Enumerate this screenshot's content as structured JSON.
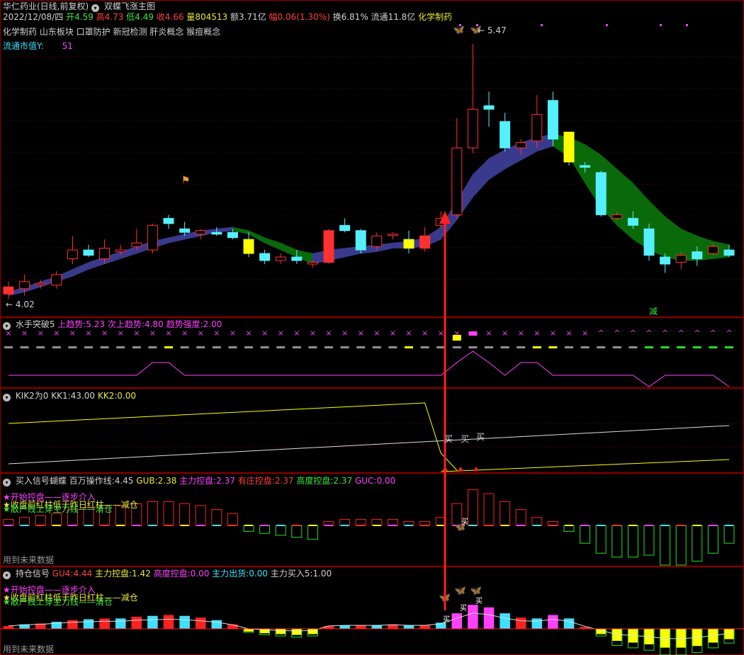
{
  "header": {
    "stock_name": "华仁药业(日线,前复权)",
    "formula_name": "双蝶飞涨主图",
    "date": "2022/12/08/四",
    "open_label": "开",
    "open": "4.59",
    "high_label": "高",
    "high": "4.73",
    "low_label": "低",
    "low": "4.49",
    "close_label": "收",
    "close": "4.66",
    "volume_label": "量",
    "volume": "804513",
    "amount_label": "额",
    "amount": "3.71亿",
    "change_label": "幅",
    "change": "0.06(1.30%)",
    "turnover_label": "换",
    "turnover": "6.81%",
    "float_label": "流通",
    "float_value": "11.8亿",
    "industry": "化学制药",
    "concepts": "化学制药 山东板块 口罩防护 新冠检测 肝炎概念 猴痘概念",
    "float_cap_label": "流通市值Y:",
    "float_cap_value": "51"
  },
  "main_chart": {
    "high_mark": "5.47",
    "low_mark": "4.02",
    "reduce_label": "减"
  },
  "panel1": {
    "name": "水手突破5",
    "l1": "上趋势:",
    "v1": "5.23",
    "l2": "次上趋势:",
    "v2": "4.80",
    "l3": "趋势强度:",
    "v3": "2.00"
  },
  "panel2": {
    "name": "KIK2为0",
    "l1": "KK1:",
    "v1": "43.00",
    "l2": "KK2:",
    "v2": "0.00",
    "buy_label": "买"
  },
  "panel3": {
    "name": "买入信号蝴蝶",
    "l1": "百万操作线:",
    "v1": "4.45",
    "l2": "GUB:",
    "v2": "2.38",
    "l3": "主力控盘:",
    "v3": "2.37",
    "l4": "有庄控盘:",
    "v4": "2.37",
    "l5": "高度控盘:",
    "v5": "2.37",
    "l6": "GUC:",
    "v6": "0.00",
    "legend1": "★开始控盘——逐步介入",
    "legend2": "★收盘前红柱低于昨日红柱——减仓",
    "legend3": "★散户线上穿主力线——清仓",
    "footer": "用到未来数据"
  },
  "panel4": {
    "name": "持仓信号",
    "l1": "GU4:",
    "v1": "4.44",
    "l2": "主力控盘:",
    "v2": "1.42",
    "l3": "高度控盘:",
    "v3": "0.00",
    "l4": "主力出货:",
    "v4": "0.00",
    "l5": "主力买入5:",
    "v5": "1.00",
    "legend1": "★开始控盘——逐步介入",
    "legend2": "★收盘前红柱低于昨日红柱——减仓",
    "legend3": "★散户线上穿主力线——清仓",
    "footer": "用到未来数据"
  },
  "colors": {
    "up": "#ff3030",
    "down": "#54f0ff",
    "ribbon_up": "#3a3a8c",
    "ribbon_down": "#0a6a0a",
    "yellow": "#ffff00",
    "magenta": "#ff40ff",
    "grid": "#800000"
  },
  "chart_data": [
    {
      "type": "candlestick",
      "title": "双蝶飞涨主图",
      "ylim": [
        3.95,
        5.6
      ],
      "candles": [
        {
          "o": 4.05,
          "h": 4.12,
          "l": 4.02,
          "c": 4.09,
          "mark": "red"
        },
        {
          "o": 4.08,
          "h": 4.16,
          "l": 4.04,
          "c": 4.12
        },
        {
          "o": 4.11,
          "h": 4.13,
          "l": 4.08,
          "c": 4.11,
          "mark": "doji"
        },
        {
          "o": 4.1,
          "h": 4.18,
          "l": 4.08,
          "c": 4.16
        },
        {
          "o": 4.25,
          "h": 4.38,
          "l": 4.22,
          "c": 4.3
        },
        {
          "o": 4.3,
          "h": 4.33,
          "l": 4.26,
          "c": 4.27
        },
        {
          "o": 4.25,
          "h": 4.36,
          "l": 4.22,
          "c": 4.31
        },
        {
          "o": 4.29,
          "h": 4.33,
          "l": 4.27,
          "c": 4.3
        },
        {
          "o": 4.32,
          "h": 4.42,
          "l": 4.3,
          "c": 4.34
        },
        {
          "o": 4.3,
          "h": 4.45,
          "l": 4.28,
          "c": 4.44
        },
        {
          "o": 4.48,
          "h": 4.5,
          "l": 4.42,
          "c": 4.45
        },
        {
          "o": 4.42,
          "h": 4.46,
          "l": 4.38,
          "c": 4.4
        },
        {
          "o": 4.39,
          "h": 4.42,
          "l": 4.36,
          "c": 4.41
        },
        {
          "o": 4.4,
          "h": 4.43,
          "l": 4.38,
          "c": 4.39
        },
        {
          "o": 4.4,
          "h": 4.42,
          "l": 4.36,
          "c": 4.37
        },
        {
          "o": 4.36,
          "h": 4.4,
          "l": 4.26,
          "c": 4.28,
          "mark": "yellow"
        },
        {
          "o": 4.28,
          "h": 4.3,
          "l": 4.22,
          "c": 4.24
        },
        {
          "o": 4.24,
          "h": 4.28,
          "l": 4.22,
          "c": 4.26
        },
        {
          "o": 4.26,
          "h": 4.3,
          "l": 4.22,
          "c": 4.24
        },
        {
          "o": 4.22,
          "h": 4.24,
          "l": 4.2,
          "c": 4.23
        },
        {
          "o": 4.23,
          "h": 4.42,
          "l": 4.22,
          "c": 4.41,
          "mark": "redsolid"
        },
        {
          "o": 4.44,
          "h": 4.48,
          "l": 4.4,
          "c": 4.41
        },
        {
          "o": 4.41,
          "h": 4.42,
          "l": 4.28,
          "c": 4.3
        },
        {
          "o": 4.32,
          "h": 4.4,
          "l": 4.3,
          "c": 4.38
        },
        {
          "o": 4.39,
          "h": 4.4,
          "l": 4.36,
          "c": 4.39,
          "mark": "doji"
        },
        {
          "o": 4.36,
          "h": 4.41,
          "l": 4.28,
          "c": 4.31,
          "mark": "yellow"
        },
        {
          "o": 4.31,
          "h": 4.43,
          "l": 4.29,
          "c": 4.38,
          "mark": "redsolid"
        },
        {
          "o": 4.44,
          "h": 4.52,
          "l": 4.42,
          "c": 4.48
        },
        {
          "o": 4.5,
          "h": 5.05,
          "l": 4.48,
          "c": 4.88
        },
        {
          "o": 4.88,
          "h": 5.47,
          "l": 4.85,
          "c": 5.1
        },
        {
          "o": 5.12,
          "h": 5.2,
          "l": 5.0,
          "c": 5.1
        },
        {
          "o": 5.03,
          "h": 5.08,
          "l": 4.86,
          "c": 4.88
        },
        {
          "o": 4.88,
          "h": 4.93,
          "l": 4.84,
          "c": 4.91
        },
        {
          "o": 4.92,
          "h": 5.18,
          "l": 4.88,
          "c": 5.07
        },
        {
          "o": 5.15,
          "h": 5.2,
          "l": 4.89,
          "c": 4.93
        },
        {
          "o": 4.97,
          "h": 4.97,
          "l": 4.78,
          "c": 4.8,
          "mark": "yellow"
        },
        {
          "o": 4.78,
          "h": 4.8,
          "l": 4.74,
          "c": 4.77
        },
        {
          "o": 4.74,
          "h": 4.75,
          "l": 4.49,
          "c": 4.5
        },
        {
          "o": 4.48,
          "h": 4.52,
          "l": 4.47,
          "c": 4.5
        },
        {
          "o": 4.48,
          "h": 4.52,
          "l": 4.42,
          "c": 4.44
        },
        {
          "o": 4.42,
          "h": 4.45,
          "l": 4.24,
          "c": 4.27
        },
        {
          "o": 4.26,
          "h": 4.28,
          "l": 4.17,
          "c": 4.22
        },
        {
          "o": 4.23,
          "h": 4.29,
          "l": 4.19,
          "c": 4.27
        },
        {
          "o": 4.29,
          "h": 4.32,
          "l": 4.21,
          "c": 4.25
        },
        {
          "o": 4.28,
          "h": 4.34,
          "l": 4.27,
          "c": 4.32
        },
        {
          "o": 4.3,
          "h": 4.33,
          "l": 4.26,
          "c": 4.27
        }
      ],
      "ribbon_top": [
        4.06,
        4.09,
        4.12,
        4.15,
        4.19,
        4.23,
        4.26,
        4.29,
        4.32,
        4.35,
        4.37,
        4.39,
        4.41,
        4.42,
        4.43,
        4.41,
        4.37,
        4.34,
        4.3,
        4.28,
        4.3,
        4.31,
        4.32,
        4.33,
        4.34,
        4.35,
        4.37,
        4.43,
        4.58,
        4.73,
        4.82,
        4.87,
        4.91,
        4.94,
        4.96,
        4.94,
        4.9,
        4.84,
        4.76,
        4.68,
        4.58,
        4.49,
        4.42,
        4.38,
        4.35,
        4.33
      ],
      "ribbon_bottom": [
        4.04,
        4.06,
        4.09,
        4.12,
        4.15,
        4.19,
        4.22,
        4.25,
        4.28,
        4.31,
        4.34,
        4.36,
        4.38,
        4.4,
        4.41,
        4.39,
        4.34,
        4.3,
        4.26,
        4.22,
        4.24,
        4.26,
        4.28,
        4.29,
        4.31,
        4.31,
        4.32,
        4.36,
        4.47,
        4.6,
        4.7,
        4.76,
        4.81,
        4.86,
        4.89,
        4.83,
        4.68,
        4.54,
        4.44,
        4.36,
        4.3,
        4.26,
        4.24,
        4.24,
        4.25,
        4.26
      ]
    },
    {
      "type": "line",
      "title": "水手突破5",
      "series": [
        {
          "name": "趋势强度",
          "values": [
            2,
            2,
            2,
            2,
            2,
            2,
            2,
            2,
            2,
            2,
            2,
            2,
            2,
            2,
            2,
            2,
            2,
            2,
            2,
            2,
            2,
            2,
            2,
            2,
            2,
            2,
            2,
            2,
            2,
            2,
            2,
            2,
            2,
            2,
            2,
            2,
            2,
            2,
            2,
            2,
            2,
            2,
            2,
            2,
            2,
            2
          ]
        }
      ]
    },
    {
      "type": "line",
      "title": "KIK2为0",
      "series": [
        {
          "name": "KK1",
          "values": [
            43,
            43,
            43,
            43,
            43,
            43,
            43,
            43,
            43,
            43,
            43,
            43,
            43,
            43,
            43,
            43,
            43,
            43,
            43,
            43,
            43,
            43,
            43,
            43,
            43,
            43,
            43,
            43,
            0,
            0,
            0,
            0,
            0,
            0,
            0,
            0,
            0,
            0,
            0,
            0,
            0,
            0,
            0,
            0,
            0,
            0
          ]
        },
        {
          "name": "KK2",
          "values": [
            0,
            0,
            0,
            0,
            0,
            0,
            0,
            0,
            0,
            0,
            0,
            0,
            0,
            0,
            0,
            0,
            0,
            0,
            0,
            0,
            0,
            0,
            0,
            0,
            0,
            0,
            0,
            0,
            0,
            0,
            0,
            0,
            0,
            0,
            0,
            0,
            0,
            0,
            0,
            0,
            0,
            0,
            0,
            0,
            0,
            0
          ]
        }
      ]
    },
    {
      "type": "bar",
      "title": "买入信号蝴蝶",
      "values": [
        0.3,
        0.4,
        0.5,
        0.6,
        0.8,
        0.9,
        1.0,
        1.0,
        1.1,
        1.2,
        1.2,
        1.1,
        1.0,
        0.8,
        0.6,
        -0.3,
        -0.4,
        -0.5,
        -0.6,
        -0.7,
        0.2,
        0.3,
        0.3,
        0.3,
        0.3,
        0.2,
        0.2,
        0.4,
        1.1,
        1.8,
        1.6,
        1.2,
        0.8,
        0.4,
        0.2,
        -0.3,
        -0.9,
        -1.4,
        -1.6,
        -1.6,
        -1.5,
        -2.0,
        -2.0,
        -1.8,
        -1.4,
        -0.9
      ]
    },
    {
      "type": "bar",
      "title": "持仓信号",
      "values": [
        0.3,
        0.5,
        0.6,
        0.8,
        1.0,
        1.1,
        1.2,
        1.2,
        1.4,
        1.5,
        1.6,
        1.5,
        1.3,
        1.0,
        0.5,
        -0.3,
        -0.5,
        -0.6,
        -0.7,
        -0.6,
        0.3,
        0.4,
        0.4,
        0.4,
        0.5,
        0.4,
        0.4,
        0.7,
        1.8,
        2.8,
        2.5,
        1.8,
        1.3,
        1.2,
        1.6,
        1.2,
        0.2,
        -0.6,
        -1.4,
        -1.6,
        -1.8,
        -2.2,
        -2.2,
        -2.0,
        -1.6,
        -1.2
      ]
    }
  ]
}
